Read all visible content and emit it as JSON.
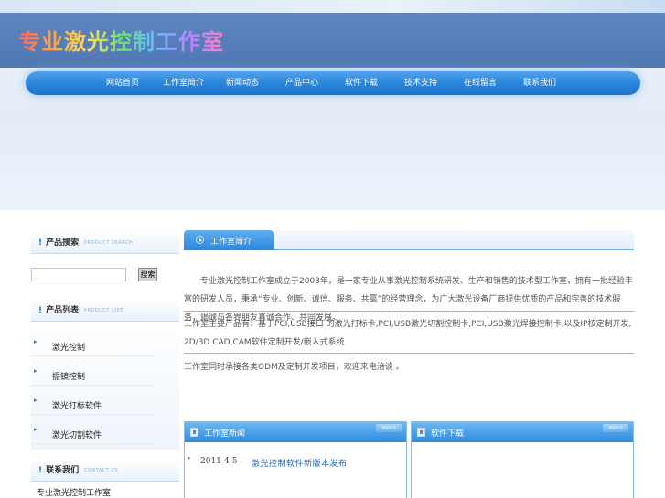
{
  "header": {
    "logo_text": "专业激光控制工作室",
    "nav": [
      "网站首页",
      "工作室简介",
      "新闻动态",
      "产品中心",
      "软件下载",
      "技术支持",
      "在线留言",
      "联系我们"
    ]
  },
  "sidebar": {
    "search": {
      "title": "产品搜索",
      "title_en": "PRODUCT SEARCH",
      "input_value": "",
      "button_label": "搜索"
    },
    "products": {
      "title": "产品列表",
      "title_en": "PRODUCT LIST",
      "items": [
        "激光控制",
        "振镜控制",
        "激光打标软件",
        "激光切割软件"
      ]
    },
    "contact": {
      "title": "联系我们",
      "title_en": "CONTACT US",
      "text": "专业激光控制工作室"
    }
  },
  "main": {
    "intro_title": "工作室简介",
    "paragraph1": "　　专业激光控制工作室成立于2003年，是一家专业从事激光控制系统研发、生产和销售的技术型工作室，拥有一批经验丰富的研发人员，秉承“专业、创新、诚信、服务、共赢”的经营理念，为广大激光设备厂商提供优质的产品和完善的技术服务，竭诚与各界朋友真诚合作、共同发展。",
    "paragraph2": "工作室主要产品有：基于PCI,USB接口 的激光打标卡,PCI,USB激光切割控制卡,PCI,USB激光焊接控制卡,以及IP核定制开发, 2D/3D CAD,CAM软件定制开发/嵌入式系统",
    "paragraph3": "工作室同时承接各类ODM及定制开发项目，欢迎来电洽谈 。"
  },
  "news_box": {
    "title": "工作室新闻",
    "more_label": "more",
    "items": [
      {
        "date": "2011-4-5",
        "title": "激光控制软件新版本发布"
      }
    ]
  },
  "download_box": {
    "title": "软件下载",
    "more_label": "more"
  }
}
